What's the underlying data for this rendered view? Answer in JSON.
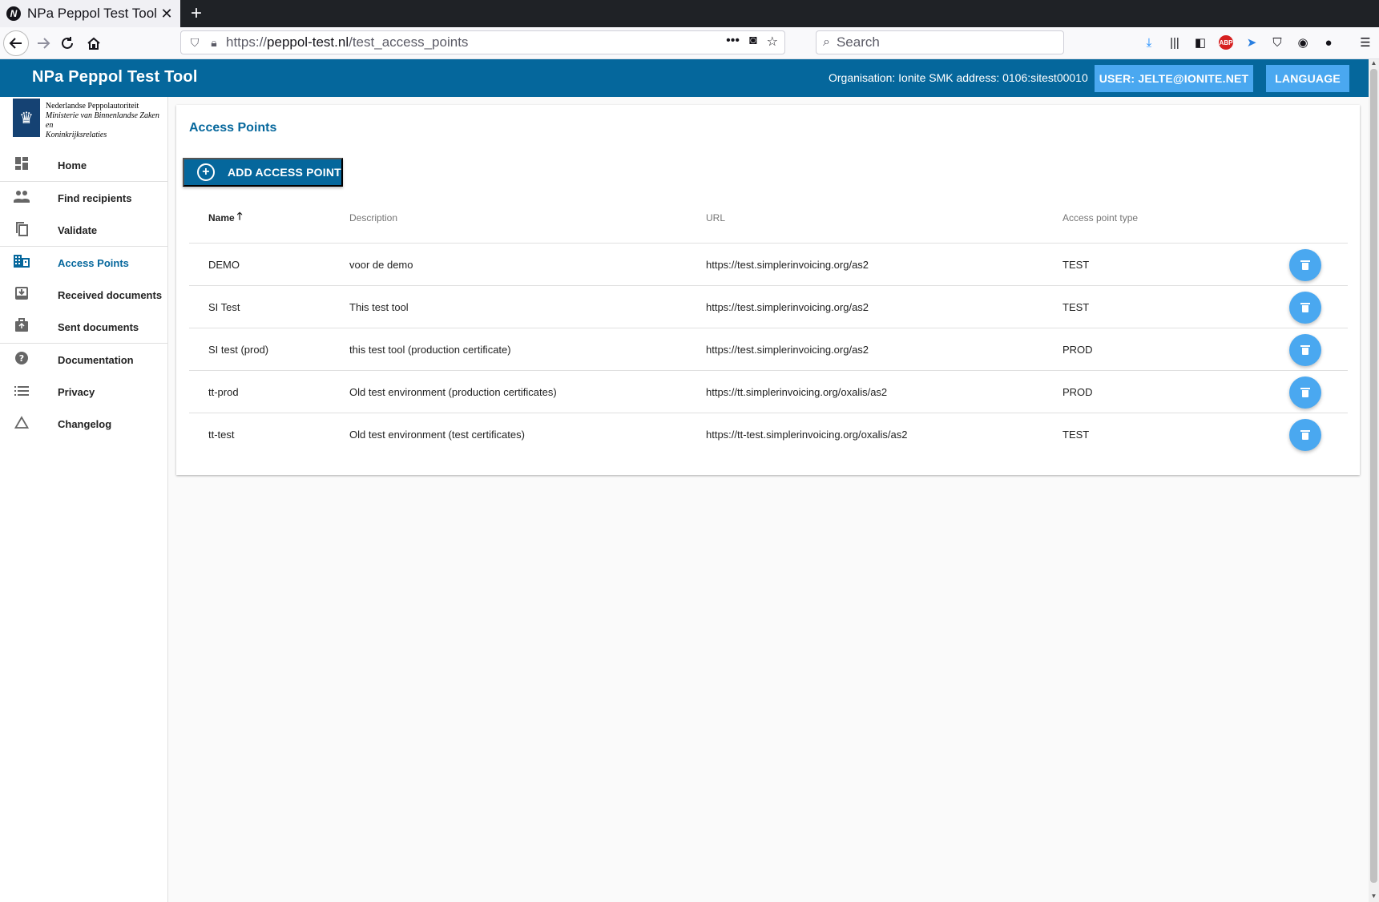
{
  "browser": {
    "tab_title": "NPa Peppol Test Tool",
    "tab_favicon_letter": "N",
    "tab_close": "✕",
    "new_tab": "+",
    "url_scheme": "https://",
    "url_host": "peppol-test.nl",
    "url_path": "/test_access_points",
    "search_placeholder": "Search"
  },
  "header": {
    "title": "NPa Peppol Test Tool",
    "organisation": "Organisation: Ionite SMK address: 0106:sitest00010",
    "user_button": "USER: JELTE@IONITE.NET",
    "language_button": "LANGUAGE",
    "color": "#05679c",
    "button_color": "#4aa8f0"
  },
  "logo": {
    "line1": "Nederlandse Peppolautoriteit",
    "line2": "Ministerie van Binnenlandse Zaken en",
    "line3": "Koninkrijksrelaties"
  },
  "sidebar": {
    "items": [
      {
        "label": "Home",
        "icon": "dashboard-icon"
      },
      {
        "label": "Find recipients",
        "icon": "people-icon"
      },
      {
        "label": "Validate",
        "icon": "copy-icon"
      },
      {
        "label": "Access Points",
        "icon": "building-icon",
        "active": true
      },
      {
        "label": "Received documents",
        "icon": "inbox-icon"
      },
      {
        "label": "Sent documents",
        "icon": "briefcase-icon"
      },
      {
        "label": "Documentation",
        "icon": "help-icon"
      },
      {
        "label": "Privacy",
        "icon": "list-icon"
      },
      {
        "label": "Changelog",
        "icon": "triangle-icon"
      }
    ]
  },
  "main": {
    "title": "Access Points",
    "add_button": "ADD ACCESS POINT",
    "table": {
      "columns": [
        "Name",
        "Description",
        "URL",
        "Access point type"
      ],
      "sorted_column": "Name",
      "rows": [
        {
          "name": "DEMO",
          "description": "voor de demo",
          "url": "https://test.simplerinvoicing.org/as2",
          "type": "TEST"
        },
        {
          "name": "SI Test",
          "description": "This test tool",
          "url": "https://test.simplerinvoicing.org/as2",
          "type": "TEST"
        },
        {
          "name": "SI test (prod)",
          "description": "this test tool (production certificate)",
          "url": "https://test.simplerinvoicing.org/as2",
          "type": "PROD"
        },
        {
          "name": "tt-prod",
          "description": "Old test environment (production certificates)",
          "url": "https://tt.simplerinvoicing.org/oxalis/as2",
          "type": "PROD"
        },
        {
          "name": "tt-test",
          "description": "Old test environment (test certificates)",
          "url": "https://tt-test.simplerinvoicing.org/oxalis/as2",
          "type": "TEST"
        }
      ]
    }
  }
}
